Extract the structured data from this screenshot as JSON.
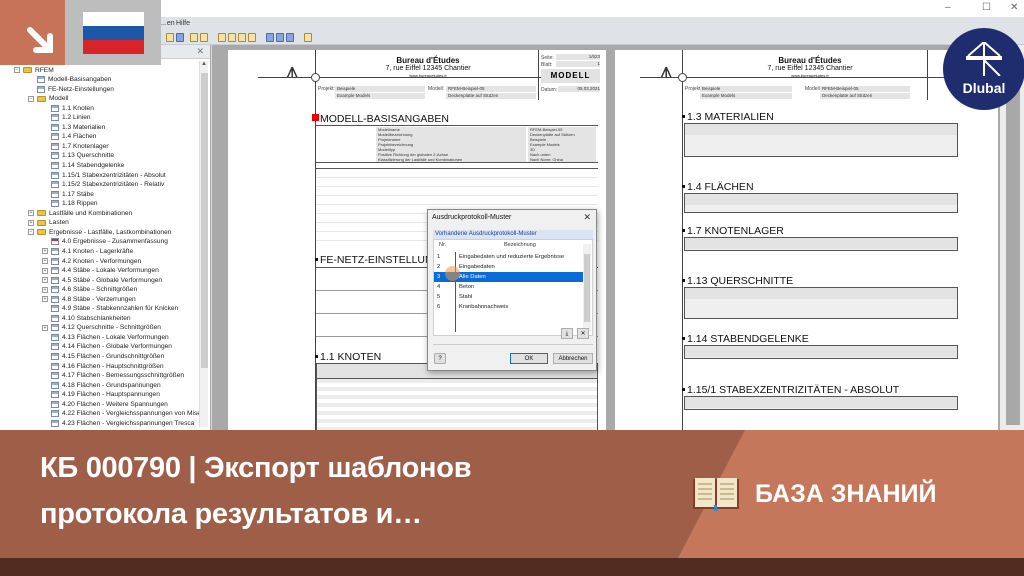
{
  "window": {
    "menu": [
      "...en",
      "Hilfe"
    ],
    "controls": [
      "–",
      "☐",
      "✕"
    ]
  },
  "tree": {
    "items": [
      {
        "label": "RFEM",
        "level": 0,
        "icon": "folder",
        "expander": "−"
      },
      {
        "label": "Modell-Basisangaben",
        "level": 1,
        "icon": "table"
      },
      {
        "label": "FE-Netz-Einstellungen",
        "level": 1,
        "icon": "table"
      },
      {
        "label": "Modell",
        "level": 1,
        "icon": "folder",
        "expander": "−"
      },
      {
        "label": "1.1 Knoten",
        "level": 2,
        "icon": "table"
      },
      {
        "label": "1.2 Linien",
        "level": 2,
        "icon": "table"
      },
      {
        "label": "1.3 Materialien",
        "level": 2,
        "icon": "table"
      },
      {
        "label": "1.4 Flächen",
        "level": 2,
        "icon": "table"
      },
      {
        "label": "1.7 Knotenlager",
        "level": 2,
        "icon": "table"
      },
      {
        "label": "1.13 Querschnitte",
        "level": 2,
        "icon": "table"
      },
      {
        "label": "1.14 Stabendgelenke",
        "level": 2,
        "icon": "table"
      },
      {
        "label": "1.15/1 Stabexzentrizitäten - Absolut",
        "level": 2,
        "icon": "table"
      },
      {
        "label": "1.15/2 Stabexzentrizitäten - Relativ",
        "level": 2,
        "icon": "table"
      },
      {
        "label": "1.17 Stäbe",
        "level": 2,
        "icon": "table"
      },
      {
        "label": "1.18 Rippen",
        "level": 2,
        "icon": "table"
      },
      {
        "label": "Lastfälle und Kombinationen",
        "level": 1,
        "icon": "folder",
        "expander": "+"
      },
      {
        "label": "Lasten",
        "level": 1,
        "icon": "folder",
        "expander": "+"
      },
      {
        "label": "Ergebnisse - Lastfälle, Lastkombinationen",
        "level": 1,
        "icon": "folder",
        "expander": "−"
      },
      {
        "label": "4.0 Ergebnisse - Zusammenfassung",
        "level": 2,
        "icon": "table-red"
      },
      {
        "label": "4.1 Knoten - Lagerkräfte",
        "level": 2,
        "icon": "table",
        "expander": "+"
      },
      {
        "label": "4.2 Knoten - Verformungen",
        "level": 2,
        "icon": "table",
        "expander": "+"
      },
      {
        "label": "4.4 Stäbe - Lokale Verformungen",
        "level": 2,
        "icon": "table",
        "expander": "+"
      },
      {
        "label": "4.5 Stäbe - Globale Verformungen",
        "level": 2,
        "icon": "table",
        "expander": "+"
      },
      {
        "label": "4.6 Stäbe - Schnittgrößen",
        "level": 2,
        "icon": "table",
        "expander": "+"
      },
      {
        "label": "4.8 Stäbe - Verzerrungen",
        "level": 2,
        "icon": "table",
        "expander": "+"
      },
      {
        "label": "4.9 Stäbe - Stabkennzahlen für Knicken",
        "level": 2,
        "icon": "table"
      },
      {
        "label": "4.10 Stabschlankheiten",
        "level": 2,
        "icon": "table"
      },
      {
        "label": "4.12 Querschnitte - Schnittgrößen",
        "level": 2,
        "icon": "table",
        "expander": "+"
      },
      {
        "label": "4.13 Flächen - Lokale Verformungen",
        "level": 2,
        "icon": "table"
      },
      {
        "label": "4.14 Flächen - Globale Verformungen",
        "level": 2,
        "icon": "table"
      },
      {
        "label": "4.15 Flächen - Grundschnittgrößen",
        "level": 2,
        "icon": "table"
      },
      {
        "label": "4.16 Flächen - Hauptschnittgrößen",
        "level": 2,
        "icon": "table"
      },
      {
        "label": "4.17 Flächen - Bemessungsschnittgrößen",
        "level": 2,
        "icon": "table"
      },
      {
        "label": "4.18 Flächen - Grundspannungen",
        "level": 2,
        "icon": "table"
      },
      {
        "label": "4.19 Flächen - Hauptspannungen",
        "level": 2,
        "icon": "table"
      },
      {
        "label": "4.20 Flächen - Weitere Spannungen",
        "level": 2,
        "icon": "table"
      },
      {
        "label": "4.22 Flächen - Vergleichsspannungen von Mises",
        "level": 2,
        "icon": "table"
      },
      {
        "label": "4.23 Flächen - Vergleichsspannungen Tresca",
        "level": 2,
        "icon": "table"
      }
    ]
  },
  "report": {
    "company": "Bureau d'Études",
    "address": "7, rue Eiffel     12345 Chantier",
    "website": "www.bureauetudes.fr",
    "seite_label": "Seite:",
    "seite": "1/623",
    "blatt_label": "Blatt:",
    "blatt": "1",
    "modell_badge": "MODELL",
    "projekt_label": "Projekt:",
    "projekt": "Beispiele",
    "projekt2": "Example Models",
    "modell_label": "Modell:",
    "modell": "RFEM-Beispiel-05",
    "modell2": "Deckenplatte auf Stützen",
    "datum_label": "Datum:",
    "datum": "05.03.2021",
    "left_sections": [
      "MODELL-BASISANGABEN",
      "FE-NETZ-EINSTELLUNGEN",
      "1.1 KNOTEN"
    ],
    "right_sections": [
      "1.3 MATERIALIEN",
      "1.4 FLÄCHEN",
      "1.7 KNOTENLAGER",
      "1.13 QUERSCHNITTE",
      "1.14 STABENDGELENKE",
      "1.15/1 STABEXZENTRIZITÄTEN - ABSOLUT"
    ],
    "basis_rows": [
      "Modellname",
      "Modellbezeichnung",
      "Projektname",
      "Projektbezeichnung",
      "Modelltyp",
      "Positive Richtung der globalen Z-Achse",
      "Klassifizierung der Lastfälle und Kombinationen"
    ],
    "basis_values": [
      "RFEM-Beispiel-05",
      "Deckenplatte auf Stützen",
      "Beispiele",
      "Example Models",
      "3D",
      "Nach unten",
      "Nach Norm: China"
    ]
  },
  "dialog": {
    "title": "Ausdruckprotokoll-Muster",
    "group": "Vorhandene Ausdruckprotokoll-Muster",
    "col_nr": "Nr.",
    "col_name": "Bezeichnung",
    "rows": [
      {
        "nr": "1",
        "name": "Eingabedaten und reduzierte Ergebnisse"
      },
      {
        "nr": "2",
        "name": "Eingabedaten"
      },
      {
        "nr": "3",
        "name": "Alle Daten"
      },
      {
        "nr": "4",
        "name": "Beton"
      },
      {
        "nr": "5",
        "name": "Stahl"
      },
      {
        "nr": "6",
        "name": "Kranbahnnachweis"
      }
    ],
    "selected": "3",
    "ok": "OK",
    "cancel": "Abbrechen",
    "help": "?",
    "close": "✕"
  },
  "brand": {
    "logo_text": "Dlubal"
  },
  "banner": {
    "title_line1": "КБ 000790 | Экспорт шаблонов",
    "title_line2": "протокола результатов и…",
    "category": "БАЗА ЗНАНИЙ"
  },
  "colors": {
    "banner_dark": "#9e5e48",
    "banner_light": "#c5775c",
    "footer": "#522c20",
    "selection": "#0a6ad6",
    "brand": "#1f2d6e"
  }
}
